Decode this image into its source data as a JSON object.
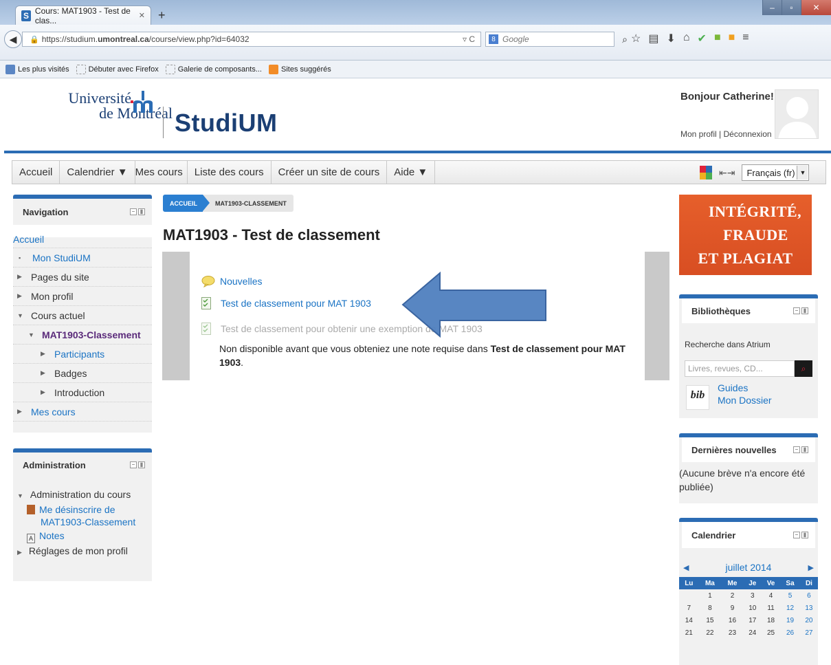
{
  "browser": {
    "tab_title": "Cours: MAT1903 - Test de clas...",
    "tab_favicon": "S",
    "url_prefix": "https://studium.",
    "url_domain": "umontreal.ca",
    "url_path": "/course/view.php?id=64032",
    "search_placeholder": "Google",
    "bookmarks": [
      "Les plus visités",
      "Débuter avec Firefox",
      "Galerie de composants...",
      "Sites suggérés"
    ]
  },
  "header": {
    "udem_line1": "Université",
    "udem_line2": "de Montréal",
    "brand": "StudiUM",
    "greeting": "Bonjour Catherine!",
    "profile_link": "Mon profil",
    "separator": "|",
    "logout_link": "Déconnexion"
  },
  "menu": {
    "items": [
      "Accueil",
      "Calendrier ▼",
      "Mes cours",
      "Liste des cours",
      "Créer un site de cours",
      "Aide ▼"
    ],
    "language": "Français (fr)"
  },
  "navigation": {
    "title": "Navigation",
    "home": "Accueil",
    "items": [
      "Mon StudiUM",
      "Pages du site",
      "Mon profil",
      "Cours actuel",
      "MAT1903-Classement",
      "Participants",
      "Badges",
      "Introduction",
      "Mes cours"
    ]
  },
  "administration": {
    "title": "Administration",
    "course_admin": "Administration du cours",
    "unenrol_line1": "Me désinscrire de",
    "unenrol_line2": "MAT1903-Classement",
    "grades": "Notes",
    "profile_settings": "Réglages de mon profil"
  },
  "breadcrumb": {
    "home": "ACCUEIL",
    "current": "MAT1903-CLASSEMENT"
  },
  "main": {
    "title": "MAT1903 - Test de classement",
    "activities": {
      "news": "Nouvelles",
      "quiz1": "Test de classement pour MAT 1903",
      "quiz2": "Test de classement pour obtenir une exemption de MAT 1903"
    },
    "restriction_prefix": "Non disponible avant que vous obteniez une note requise dans ",
    "restriction_bold": "Test de classement pour MAT 1903",
    "restriction_suffix": "."
  },
  "right": {
    "banner": [
      "INTÉGRITÉ,",
      "FRAUDE",
      "ET PLAGIAT"
    ],
    "library_title": "Bibliothèques",
    "library_search_label": "Recherche dans Atrium",
    "library_search_placeholder": "Livres, revues, CD...",
    "bib_logo": "bib",
    "guides": "Guides",
    "my_file": "Mon Dossier",
    "news_title": "Dernières nouvelles",
    "news_empty": "(Aucune brève n'a encore été publiée)",
    "calendar_title": "Calendrier",
    "calendar_month": "juillet 2014",
    "calendar_days": [
      "Lu",
      "Ma",
      "Me",
      "Je",
      "Ve",
      "Sa",
      "Di"
    ],
    "calendar_weeks": [
      [
        "",
        "1",
        "2",
        "3",
        "4",
        "5",
        "6"
      ],
      [
        "7",
        "8",
        "9",
        "10",
        "11",
        "12",
        "13"
      ],
      [
        "14",
        "15",
        "16",
        "17",
        "18",
        "19",
        "20"
      ],
      [
        "21",
        "22",
        "23",
        "24",
        "25",
        "26",
        "27"
      ]
    ]
  },
  "colors": {
    "brand_blue": "#2b6cb4",
    "link_blue": "#1a73c4",
    "banner_orange": "#e65f2b"
  }
}
